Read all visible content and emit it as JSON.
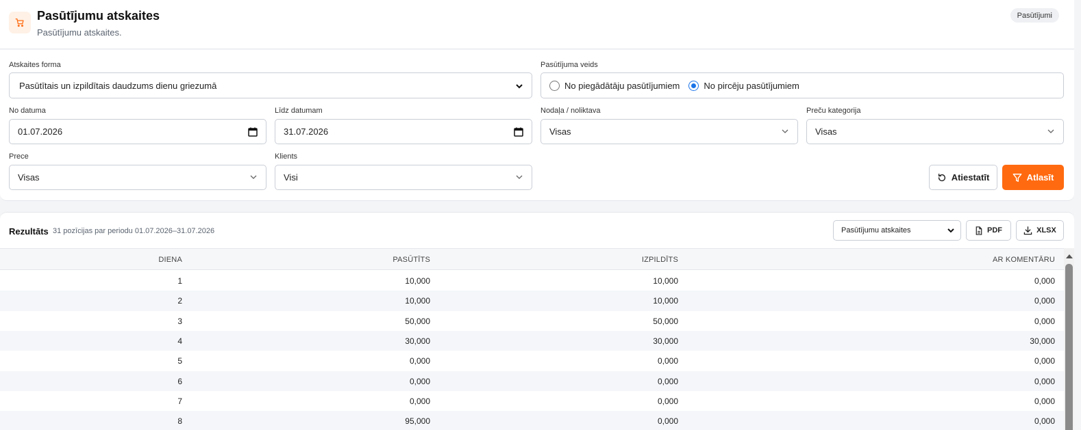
{
  "header": {
    "title": "Pasūtījumu atskaites",
    "subtitle": "Pasūtījumu atskaites.",
    "badge": "Pasūtījumi",
    "icon": "cart-icon"
  },
  "filters": {
    "report_form": {
      "label": "Atskaites forma",
      "value": "Pasūtītais un izpildītais daudzums dienu griezumā"
    },
    "order_type": {
      "label": "Pasūtījuma veids",
      "options": [
        {
          "label": "No piegādātāju pasūtījumiem",
          "selected": false
        },
        {
          "label": "No pircēju pasūtījumiem",
          "selected": true
        }
      ]
    },
    "date_from": {
      "label": "No datuma",
      "value": "01.07.2026"
    },
    "date_to": {
      "label": "Līdz datumam",
      "value": "31.07.2026"
    },
    "department": {
      "label": "Nodaļa / noliktava",
      "value": "Visas"
    },
    "category": {
      "label": "Preču kategorija",
      "value": "Visas"
    },
    "product": {
      "label": "Prece",
      "value": "Visas"
    },
    "client": {
      "label": "Klients",
      "value": "Visi"
    },
    "reset_label": "Atiestatīt",
    "apply_label": "Atlasīt"
  },
  "results": {
    "title": "Rezultāts",
    "summary": "31 pozīcijas par periodu 01.07.2026–31.07.2026",
    "report_select": "Pasūtījumu atskaites",
    "pdf_label": "PDF",
    "xlsx_label": "XLSX",
    "columns": [
      "DIENA",
      "PASŪTĪTS",
      "IZPILDĪTS",
      "AR KOMENTĀRU"
    ],
    "rows": [
      [
        "1",
        "10,000",
        "10,000",
        "0,000"
      ],
      [
        "2",
        "10,000",
        "10,000",
        "0,000"
      ],
      [
        "3",
        "50,000",
        "50,000",
        "0,000"
      ],
      [
        "4",
        "30,000",
        "30,000",
        "30,000"
      ],
      [
        "5",
        "0,000",
        "0,000",
        "0,000"
      ],
      [
        "6",
        "0,000",
        "0,000",
        "0,000"
      ],
      [
        "7",
        "0,000",
        "0,000",
        "0,000"
      ],
      [
        "8",
        "95,000",
        "0,000",
        "0,000"
      ]
    ]
  },
  "colors": {
    "accent": "#ff6a10",
    "radio": "#1a73e8"
  }
}
